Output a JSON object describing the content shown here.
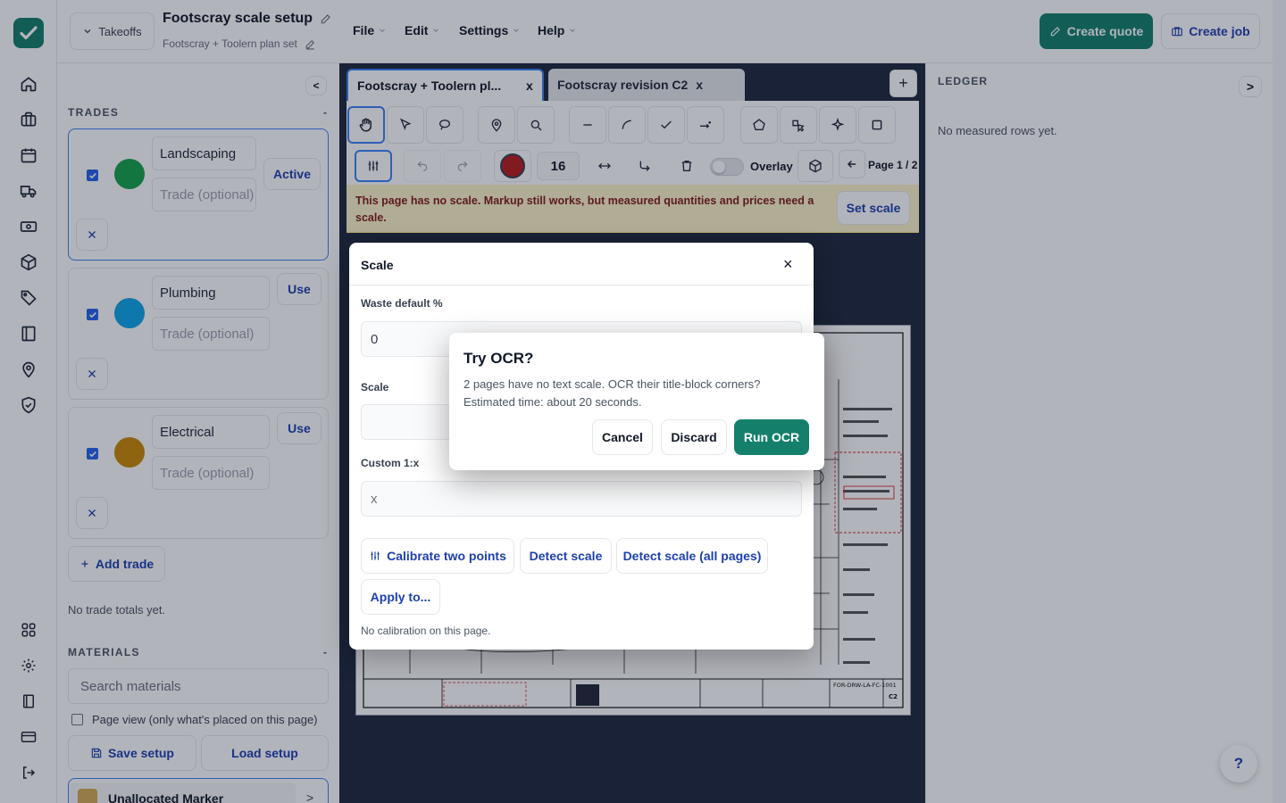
{
  "app": {
    "brand_color": "#14806b"
  },
  "header": {
    "takeoffs_label": "Takeoffs",
    "title": "Footscray scale setup",
    "subtitle": "Footscray + Toolern plan set",
    "menus": [
      "File",
      "Edit",
      "Settings",
      "Help"
    ],
    "create_quote": "Create quote",
    "create_job": "Create job"
  },
  "sidebar": {
    "collapse": "<",
    "trades_title": "TRADES",
    "trades_toggle": "-",
    "trades": [
      {
        "name": "Landscaping",
        "placeholder": "Trade (optional)",
        "action": "Active",
        "color": "#16a34a"
      },
      {
        "name": "Plumbing",
        "placeholder": "Trade (optional)",
        "action": "Use",
        "color": "#0ea5e9"
      },
      {
        "name": "Electrical",
        "placeholder": "Trade (optional)",
        "action": "Use",
        "color": "#ca8a04"
      }
    ],
    "add_trade": "Add trade",
    "no_totals": "No trade totals yet.",
    "materials_title": "MATERIALS",
    "materials_toggle": "-",
    "search_placeholder": "Search materials",
    "page_view": "Page view (only what's placed on this page)",
    "save_setup": "Save setup",
    "load_setup": "Load setup",
    "unallocated": "Unallocated Marker",
    "unallocated_arrow": ">"
  },
  "viewer": {
    "tabs": [
      {
        "label": "Footscray + Toolern pl...",
        "close": "x"
      },
      {
        "label": "Footscray revision C2",
        "close": "x"
      }
    ],
    "add_tab": "+",
    "stroke_size": "16",
    "overlay_label": "Overlay",
    "page_label": "Page 1 / 2",
    "warning": "This page has no scale. Markup still works, but measured quantities and prices need a scale.",
    "set_scale": "Set scale",
    "marker_color": "#b91c1c",
    "drawing_number": "FOR-DRW-LA-FC-1001",
    "revision": "C2"
  },
  "ledger": {
    "title": "LEDGER",
    "toggle": ">",
    "empty": "No measured rows yet."
  },
  "help_label": "?",
  "scale_modal": {
    "title": "Scale",
    "close": "×",
    "waste_label": "Waste default %",
    "waste_value": "0",
    "scale_label": "Scale",
    "custom_label": "Custom 1:x",
    "custom_placeholder": "x",
    "calibrate": "Calibrate two points",
    "detect": "Detect scale",
    "detect_all": "Detect scale (all pages)",
    "apply_to": "Apply to...",
    "status": "No calibration on this page."
  },
  "ocr_dialog": {
    "title": "Try OCR?",
    "body": "2 pages have no text scale. OCR their title-block corners? Estimated time: about 20 seconds.",
    "cancel": "Cancel",
    "discard": "Discard",
    "run": "Run OCR"
  }
}
